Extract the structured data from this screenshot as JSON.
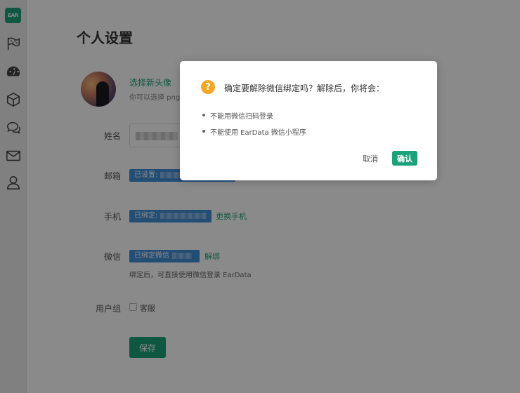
{
  "sidebar": {
    "logo": "EAR",
    "items": [
      {
        "icon": "flag-icon"
      },
      {
        "icon": "dashboard-icon"
      },
      {
        "icon": "cube-icon"
      },
      {
        "icon": "chat-icon"
      },
      {
        "icon": "mail-icon"
      },
      {
        "icon": "user-icon"
      }
    ]
  },
  "page": {
    "title": "个人设置",
    "avatar": {
      "link": "选择新头像",
      "hint": "你可以选择 png"
    },
    "fields": {
      "name_label": "姓名",
      "email_label": "邮箱",
      "email_tag": "已设置:",
      "phone_label": "手机",
      "phone_tag": "已绑定:",
      "phone_link": "更换手机",
      "wechat_label": "微信",
      "wechat_tag": "已绑定微信",
      "wechat_link": "解绑",
      "wechat_hint": "绑定后，可直接使用微信登录 EarData",
      "group_label": "用户组",
      "group_option": "客服"
    },
    "save_label": "保存"
  },
  "dialog": {
    "icon_glyph": "?",
    "title": "确定要解除微信绑定吗？解除后，你将会：",
    "bullets": [
      "不能用微信扫码登录",
      "不能使用 EarData 微信小程序"
    ],
    "cancel_label": "取消",
    "confirm_label": "确认"
  },
  "colors": {
    "accent": "#1aa37a",
    "tag_blue": "#3f8fd8",
    "warning": "#f5a623"
  }
}
